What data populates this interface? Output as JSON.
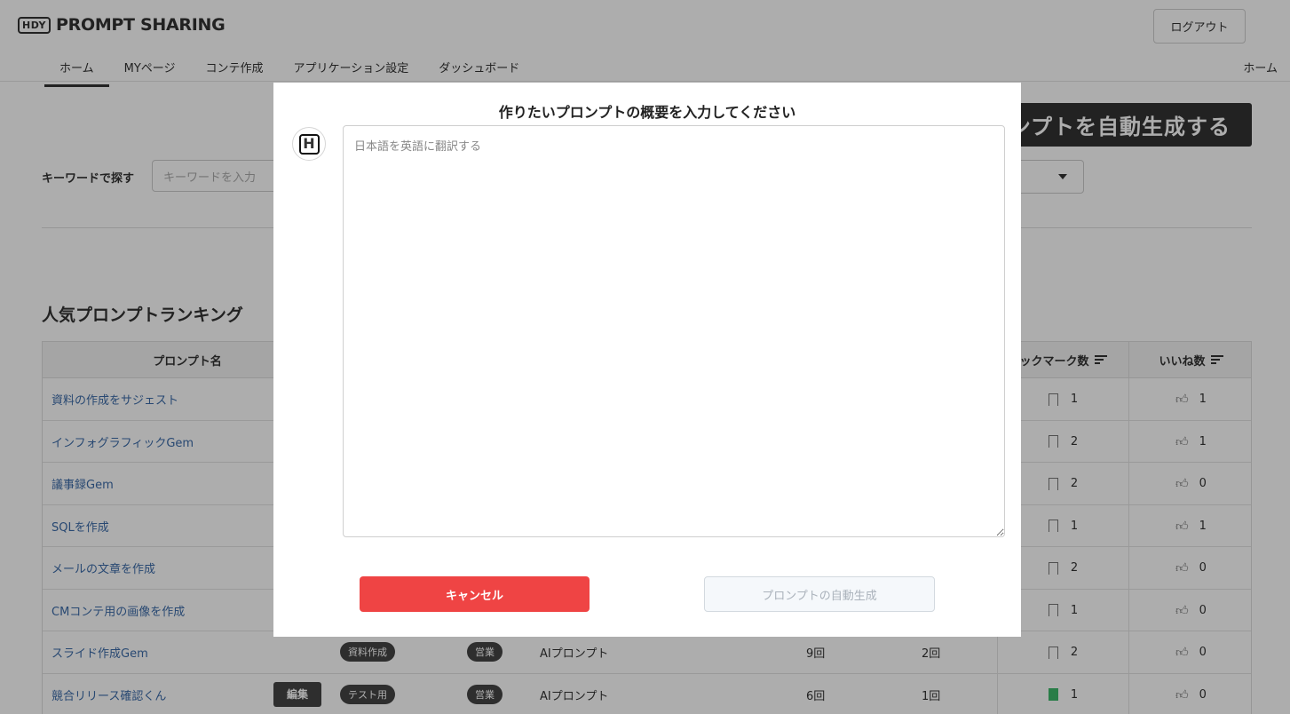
{
  "header": {
    "logo_badge": "HDY",
    "logo_text": "PROMPT SHARING",
    "logout_label": "ログアウト",
    "nav": [
      {
        "label": "ホーム"
      },
      {
        "label": "MYページ"
      },
      {
        "label": "コンテ作成"
      },
      {
        "label": "アプリケーション設定"
      },
      {
        "label": "ダッシュボード"
      }
    ],
    "breadcrumb": "ホーム"
  },
  "page": {
    "auto_generate_label": "ンプトを自動生成する",
    "keyword_label": "キーワードで探す",
    "keyword_placeholder": "キーワードを入力",
    "ranking_title": "人気プロンプトランキング",
    "table": {
      "headers": {
        "name": "プロンプト名",
        "bookmarks": "ックマーク数",
        "likes": "いいね数"
      },
      "rows": [
        {
          "name": "資料の作成をサジェスト",
          "bookmarks": "1",
          "likes": "1"
        },
        {
          "name": "インフォグラフィックGem",
          "bookmarks": "2",
          "likes": "1"
        },
        {
          "name": "議事録Gem",
          "bookmarks": "2",
          "likes": "0"
        },
        {
          "name": "SQLを作成",
          "bookmarks": "1",
          "likes": "1"
        },
        {
          "name": "メールの文章を作成",
          "bookmarks": "2",
          "likes": "0"
        },
        {
          "name": "CMコンテ用の画像を作成",
          "bookmarks": "1",
          "likes": "0"
        },
        {
          "name": "スライド作成Gem",
          "category": "資料作成",
          "department": "営業",
          "type": "AIプロンプト",
          "uses": "9回",
          "copies": "2回",
          "bookmarks": "2",
          "likes": "0"
        },
        {
          "name": "競合リリース確認くん",
          "edit_label": "編集",
          "category": "テスト用",
          "department": "営業",
          "type": "AIプロンプト",
          "uses": "6回",
          "copies": "1回",
          "bookmarks": "1",
          "likes": "0"
        }
      ]
    }
  },
  "modal": {
    "title": "作りたいプロンプトの概要を入力してください",
    "avatar_letter": "H",
    "textarea_placeholder": "日本語を英語に翻訳する",
    "cancel_label": "キャンセル",
    "generate_label": "プロンプトの自動生成"
  },
  "colors": {
    "cancel": "#ef4444",
    "link": "#3b6ba8",
    "bookmark_active": "#3db86b"
  }
}
